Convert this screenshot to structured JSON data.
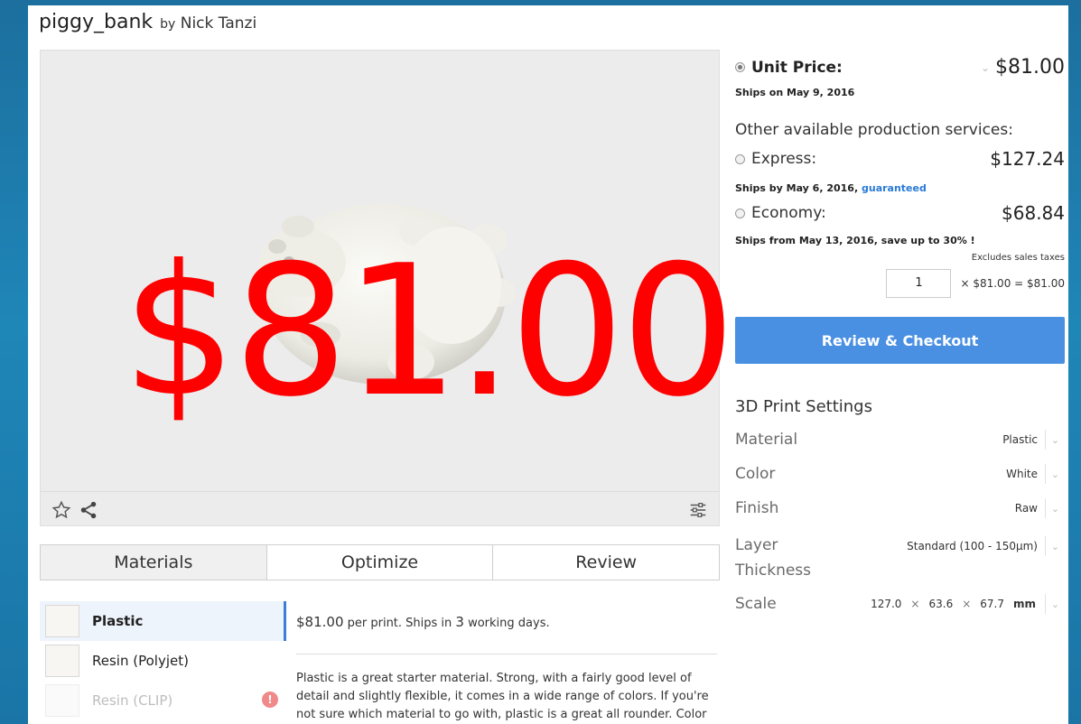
{
  "product": {
    "title": "piggy_bank",
    "by": "by",
    "author": "Nick Tanzi"
  },
  "pricing": {
    "unit_label": "Unit Price:",
    "unit_price": "$81.00",
    "unit_ships": "Ships on May 9, 2016",
    "other_title": "Other available production services:",
    "express_label": "Express:",
    "express_price": "$127.24",
    "express_ships": "Ships by May 6, 2016,",
    "express_link": "guaranteed",
    "economy_label": "Economy:",
    "economy_price": "$68.84",
    "economy_ships": "Ships from May 13, 2016, save up to 30% !",
    "taxes": "Excludes sales taxes",
    "quantity": "1",
    "calc": "× $81.00 = $81.00",
    "checkout_label": "Review & Checkout"
  },
  "settings": {
    "title": "3D Print Settings",
    "material_label": "Material",
    "material_value": "Plastic",
    "color_label": "Color",
    "color_value": "White",
    "finish_label": "Finish",
    "finish_value": "Raw",
    "layer_label_1": "Layer",
    "layer_label_2": "Thickness",
    "layer_value": "Standard (100 - 150µm)",
    "scale_label": "Scale",
    "scale_x": "127.0",
    "scale_y": "63.6",
    "scale_z": "67.7",
    "scale_sep": "×",
    "scale_unit": "mm"
  },
  "tabs": [
    "Materials",
    "Optimize",
    "Review"
  ],
  "materials": [
    {
      "label": "Plastic"
    },
    {
      "label": "Resin (Polyjet)"
    },
    {
      "label": "Resin (CLIP)"
    }
  ],
  "material_info": {
    "price": "$81.00",
    "price_rest": " per print. Ships in ",
    "days": "3",
    "days_rest": " working days.",
    "description": "Plastic is a great starter material. Strong, with a fairly good level of detail and slightly flexible, it comes in a wide range of colors. If you're not sure which material to go with, plastic is a great all rounder. Color"
  },
  "overlay_text": "$81.00",
  "icons": {
    "favorite": "star-icon",
    "share": "share-icon",
    "settings": "sliders-icon",
    "warning": "warning-icon"
  },
  "colors": {
    "accent": "#4a90e2",
    "overlay": "#ff0000",
    "background": "#1f86b8"
  }
}
